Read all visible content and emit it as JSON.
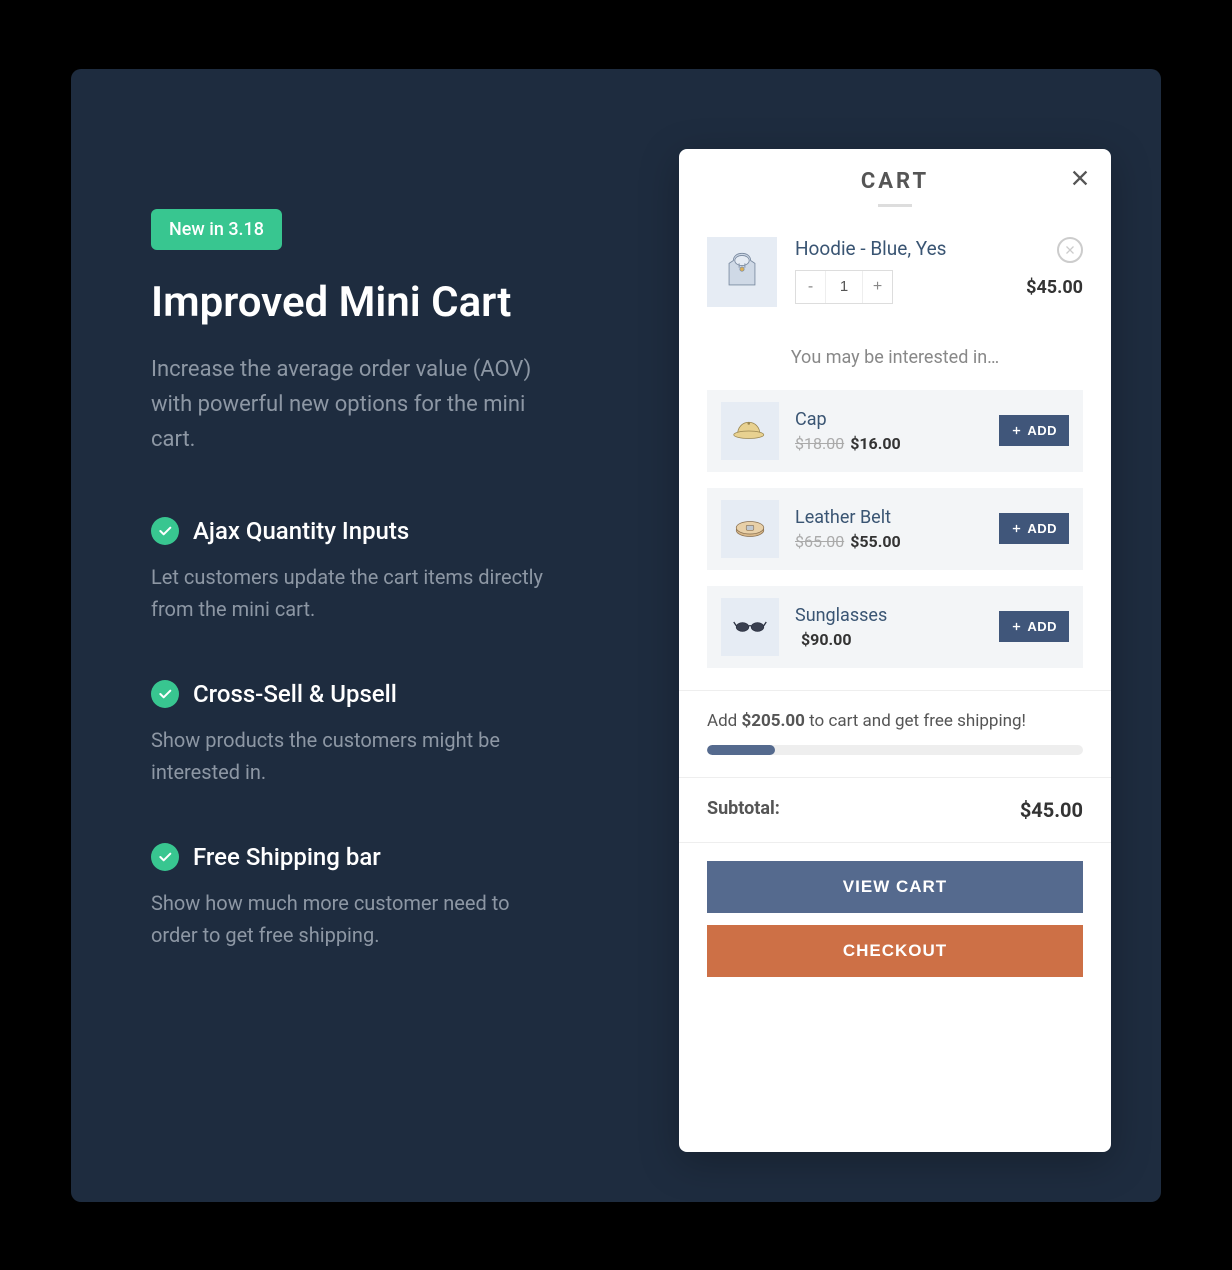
{
  "badge": "New in 3.18",
  "hero": {
    "title": "Improved Mini Cart",
    "desc": "Increase the average order value (AOV) with powerful new options for the mini cart."
  },
  "features": [
    {
      "title": "Ajax Quantity Inputs",
      "desc": "Let customers update the cart items directly from the mini cart."
    },
    {
      "title": "Cross-Sell & Upsell",
      "desc": "Show products the customers might be interested in."
    },
    {
      "title": "Free Shipping bar",
      "desc": "Show how much more customer need to order to get free shipping."
    }
  ],
  "cart": {
    "title": "CART",
    "item": {
      "name": "Hoodie - Blue, Yes",
      "qty": "1",
      "price": "$45.00",
      "minus": "-",
      "plus": "+"
    },
    "upsell_heading": "You may be interested in…",
    "upsell": [
      {
        "name": "Cap",
        "old": "$18.00",
        "new": "$16.00",
        "add": "ADD"
      },
      {
        "name": "Leather Belt",
        "old": "$65.00",
        "new": "$55.00",
        "add": "ADD"
      },
      {
        "name": "Sunglasses",
        "old": "",
        "new": "$90.00",
        "add": "ADD"
      }
    ],
    "ship_pre": "Add ",
    "ship_amount": "$205.00",
    "ship_post": " to cart and get free shipping!",
    "subtotal_label": "Subtotal:",
    "subtotal_value": "$45.00",
    "view_cart": "VIEW CART",
    "checkout": "CHECKOUT"
  }
}
